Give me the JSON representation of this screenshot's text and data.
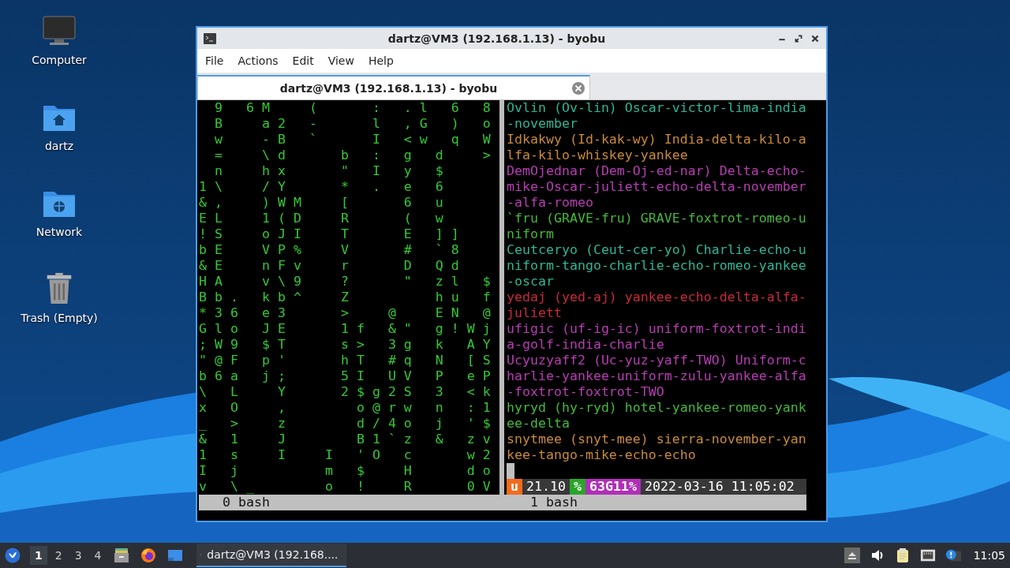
{
  "desktop_icons": [
    {
      "kind": "computer",
      "label": "Computer"
    },
    {
      "kind": "home-folder",
      "label": "dartz"
    },
    {
      "kind": "network-folder",
      "label": "Network"
    },
    {
      "kind": "trash",
      "label": "Trash (Empty)"
    }
  ],
  "window": {
    "title": "dartz@VM3 (192.168.1.13) - byobu",
    "menu": [
      "File",
      "Actions",
      "Edit",
      "View",
      "Help"
    ],
    "tab": {
      "label": "dartz@VM3 (192.168.1.13) - byobu",
      "selected": true
    },
    "left_pane": {
      "label": "0 bash",
      "matrix_rows": [
        " 9 6M  (   : .l 6 8",
        " B  a2 -   l ,G ) o",
        " w  -B `   I <w q W",
        " =  \\d   b : g d  >",
        " n  hx   \" I y $",
        "1\\  /Y   * . e 6",
        "&,  )WM  [   6 u",
        "EL  1(D  R   ( w",
        "!S  oJI  T   E ]]",
        "bE  VP%  V   # `8",
        "&E  nFv  r   D Qd",
        "HA  v\\9  ?   \" zl $",
        "Bb. kb^  Z     hu f",
        "*36 e3   >  @  EN @",
        "Glo JE   1f &\" g!Wj",
        ";W9 $T   s> 3g k AY",
        "\"@F p'   hT #q N [S",
        "b6a j;   5I UV P eP",
        "\\ L  Y   2$g2S 3 <k",
        "x O  ,    o@rw n :1",
        "_ >  z    d/4o j '$",
        "& 1  J    B1`z & zv",
        "1 s  I  I 'O c   w2",
        "I j     m $  H   do",
        "v \\_    o !  R   0V"
      ]
    },
    "right_pane": {
      "label": "1 bash",
      "lines": [
        {
          "text": "Ovlin (Ov-lin) Oscar-victor-lima-india-november",
          "color": "#2fb596"
        },
        {
          "text": "Idkakwy (Id-kak-wy) India-delta-kilo-alfa-kilo-whiskey-yankee",
          "color": "#c98a3c"
        },
        {
          "text": "DemOjednar (Dem-Oj-ed-nar) Delta-echo-mike-Oscar-juliett-echo-delta-november-alfa-romeo",
          "color": "#b83cb4"
        },
        {
          "text": "`fru (GRAVE-fru) GRAVE-foxtrot-romeo-uniform",
          "color": "#45b83a"
        },
        {
          "text": "Ceutceryo (Ceut-cer-yo) Charlie-echo-uniform-tango-charlie-echo-romeo-yankee-oscar",
          "color": "#2fb596"
        },
        {
          "text": "yedaj (yed-aj) yankee-echo-delta-alfa-juliett",
          "color": "#c82a3c"
        },
        {
          "text": "ufigic (uf-ig-ic) uniform-foxtrot-india-golf-india-charlie",
          "color": "#b83cb4"
        },
        {
          "text": "Ucyuzyaff2 (Uc-yuz-yaff-TWO) Uniform-charlie-yankee-uniform-zulu-yankee-alfa-foxtrot-foxtrot-TWO",
          "color": "#b83cb4"
        },
        {
          "text": "hyryd (hy-ryd) hotel-yankee-romeo-yankee-delta",
          "color": "#45b83a"
        },
        {
          "text": "snytmee (snyt-mee) sierra-november-yankee-tango-mike-echo-echo",
          "color": "#c98a3c"
        }
      ],
      "status": [
        {
          "text": "u",
          "color": "#f26b1d"
        },
        {
          "text": "21.10",
          "color": "#383838"
        },
        {
          "text": "%",
          "color": "#2aa52a"
        },
        {
          "text": "63G11%",
          "color": "#b02fb8"
        },
        {
          "text": "2022-03-16 11:05:02",
          "color": "#383838"
        }
      ]
    }
  },
  "taskbar": {
    "workspaces": [
      {
        "label": "1",
        "selected": true
      },
      {
        "label": "2",
        "selected": false
      },
      {
        "label": "3",
        "selected": false
      },
      {
        "label": "4",
        "selected": false
      }
    ],
    "launchers": [
      {
        "kind": "files"
      },
      {
        "kind": "browser"
      },
      {
        "kind": "folder"
      }
    ],
    "task": {
      "label": "dartz@VM3 (192.168....",
      "selected": true
    },
    "clock": "11:05"
  }
}
